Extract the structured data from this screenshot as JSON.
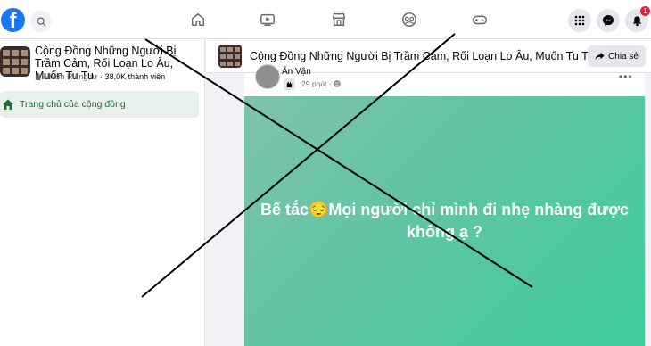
{
  "topbar": {
    "logo": "f",
    "nav_icons": [
      "home-icon",
      "watch-icon",
      "marketplace-icon",
      "groups-icon",
      "gaming-icon"
    ],
    "notifications_count": "1"
  },
  "sidebar": {
    "group_name": "Cộng Đồng Những Người Bị Trầm Cảm, Rối Loạn Lo Âu, Muốn Tu Tu",
    "privacy": "Nhóm Riêng tư",
    "separator": "·",
    "members": "38,0K thành viên",
    "home_label": "Trang chủ của cộng đồng"
  },
  "header": {
    "group_name": "Cộng Đồng Những Người Bị Trầm Cảm, Rối Loạn Lo Âu, Muốn Tu Tu",
    "share_label": "Chia sẻ"
  },
  "post": {
    "author": "Ẩn Vận",
    "time": "29 phút",
    "dot": "·",
    "more": "•••",
    "text": "Bế tắc😔Mọi người chỉ mình đi nhẹ nhàng được không ạ ?"
  },
  "colors": {
    "brand": "#1877f2",
    "post_bg_start": "#7fc3ad",
    "post_bg_end": "#3ecd9b",
    "home_highlight": "#e7f0ea",
    "notif_badge": "#e41e3f"
  }
}
